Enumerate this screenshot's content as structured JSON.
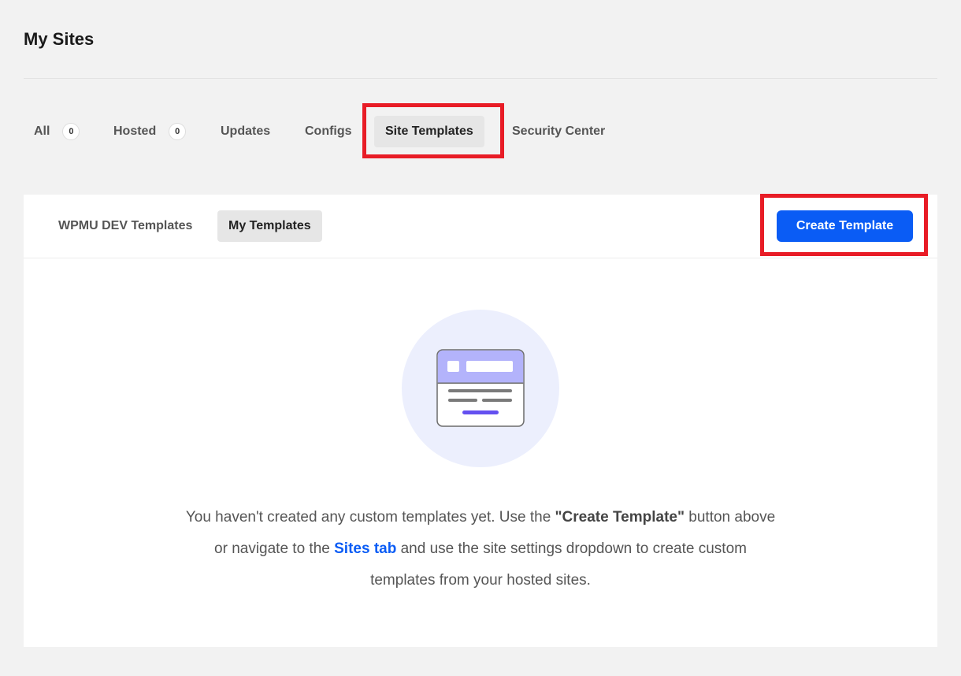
{
  "page": {
    "title": "My Sites"
  },
  "nav": {
    "tabs": [
      {
        "label": "All",
        "count": "0"
      },
      {
        "label": "Hosted",
        "count": "0"
      },
      {
        "label": "Updates"
      },
      {
        "label": "Configs"
      },
      {
        "label": "Site Templates",
        "active": true
      },
      {
        "label": "Security Center"
      }
    ]
  },
  "templates": {
    "tabs": [
      {
        "label": "WPMU DEV Templates"
      },
      {
        "label": "My Templates",
        "active": true
      }
    ],
    "create_button_label": "Create Template",
    "empty_state": {
      "illustration_icon": "template-window-icon",
      "message_part1": "You haven't created any custom templates yet. Use the ",
      "message_bold": "\"Create Template\"",
      "message_part2": " button above or navigate to the ",
      "message_link": "Sites tab",
      "message_part3": " and use the site settings dropdown to create custom templates from your hosted sites."
    }
  },
  "colors": {
    "background": "#f2f2f2",
    "primary": "#0a5cf5",
    "highlight": "#e81c26",
    "illustration_circle": "#eceffd",
    "illustration_header": "#b3b3fb",
    "illustration_accent": "#6450f0"
  }
}
